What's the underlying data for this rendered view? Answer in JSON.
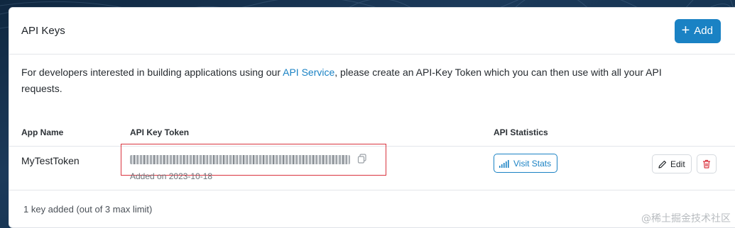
{
  "header": {
    "title": "API Keys",
    "add_label": "Add"
  },
  "description": {
    "before_link": "For developers interested in building applications using our ",
    "link": "API Service",
    "after_link": ", please create an API-Key Token which you can then use with all your API requests."
  },
  "table": {
    "columns": [
      "App Name",
      "API Key Token",
      "API Statistics"
    ],
    "rows": [
      {
        "app_name": "MyTestToken",
        "added": "Added on 2023-10-18",
        "stats_label": "Visit Stats",
        "edit_label": "Edit"
      }
    ]
  },
  "footer": {
    "summary": "1 key added (out of 3 max limit)"
  },
  "watermark": "@稀土掘金技术社区",
  "colors": {
    "accent": "#1a82c4",
    "highlight_box": "#d9343f",
    "delete_icon": "#d9343f"
  },
  "icons": [
    "plus-icon",
    "copy-icon",
    "bar-chart-icon",
    "pencil-icon",
    "trash-icon"
  ]
}
